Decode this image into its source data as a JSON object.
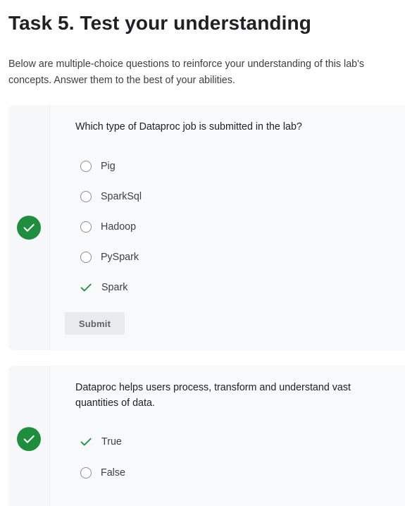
{
  "heading": "Task 5. Test your understanding",
  "intro": "Below are multiple-choice questions to reinforce your understanding of this lab's concepts. Answer them to the best of your abilities.",
  "colors": {
    "correct": "#1e8e3e",
    "card_background": "#f8f9fa"
  },
  "questions": [
    {
      "status_icon": "check-circle-icon",
      "text": "Which type of Dataproc job is submitted in the lab?",
      "options": [
        {
          "label": "Pig",
          "state": "unselected"
        },
        {
          "label": "SparkSql",
          "state": "unselected"
        },
        {
          "label": "Hadoop",
          "state": "unselected"
        },
        {
          "label": "PySpark",
          "state": "unselected"
        },
        {
          "label": "Spark",
          "state": "correct"
        }
      ],
      "submit_label": "Submit"
    },
    {
      "status_icon": "check-circle-icon",
      "text": "Dataproc helps users process, transform and understand vast quantities of data.",
      "options": [
        {
          "label": "True",
          "state": "correct"
        },
        {
          "label": "False",
          "state": "unselected"
        }
      ]
    }
  ]
}
